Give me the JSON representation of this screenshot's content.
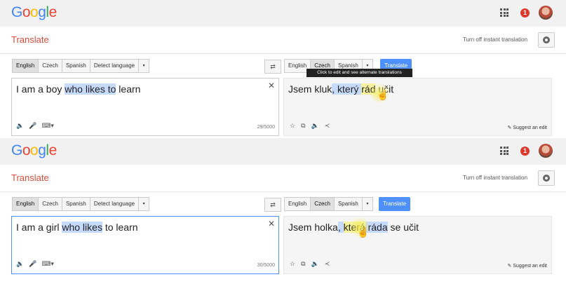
{
  "logo": {
    "letters": [
      "G",
      "o",
      "o",
      "g",
      "l",
      "e"
    ],
    "colors": [
      "#4285f4",
      "#ea4335",
      "#fbbc05",
      "#4285f4",
      "#34a853",
      "#ea4335"
    ]
  },
  "app_title": "Translate",
  "instant_link": "Turn off instant translation",
  "notif_count": "1",
  "source_langs": [
    "English",
    "Czech",
    "Spanish",
    "Detect language"
  ],
  "target_langs": [
    "English",
    "Czech",
    "Spanish"
  ],
  "translate_label": "Translate",
  "tooltip": "Click to edit and see alternate translations",
  "suggest_edit": "Suggest an edit",
  "panels": [
    {
      "source_parts": [
        "I am a boy ",
        "who likes to",
        " learn"
      ],
      "target_parts": [
        "Jsem kluk",
        ", který ",
        "rád",
        " učit"
      ],
      "count": "29/5000"
    },
    {
      "source_parts": [
        "I am a girl ",
        "who likes",
        " to learn"
      ],
      "target_parts": [
        "Jsem holka",
        ", ",
        "která",
        " ",
        "ráda",
        " se učit"
      ],
      "count": "30/5000"
    }
  ]
}
